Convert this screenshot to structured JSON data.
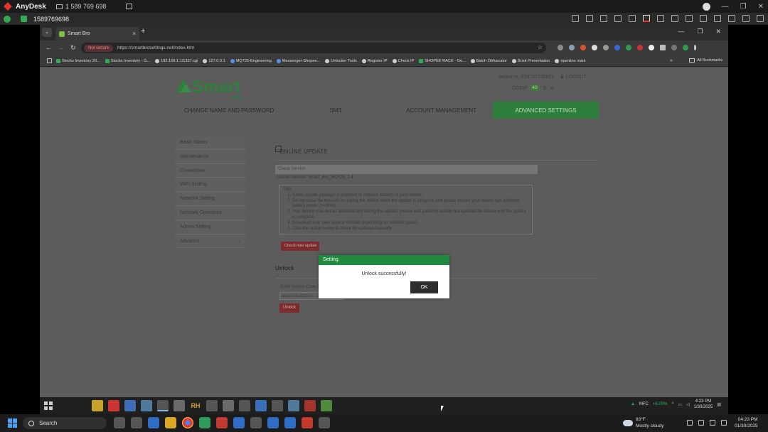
{
  "anydesk": {
    "title": "AnyDesk",
    "tab_label": "1 589 769 698",
    "session_id": "1589769698"
  },
  "browser": {
    "tab_title": "Smart Bro",
    "security": "Not secure",
    "url": "https://smartbrosettings.net/index.htm",
    "bookmarks": [
      "Stocks Inventory 20...",
      "Stocks Inventory - G...",
      "192.168.1.1/1337.cgi",
      "127.0.0.1",
      "MQ725-Engineering",
      "Messenger-Shopee...",
      "Unlocker Tools",
      "Register IP",
      "Check IP",
      "SHOPEE RACK - Go...",
      "Batch Obfuscator",
      "Brisk Presentation",
      "openline mark"
    ],
    "all_bookmarks": "All Bookmarks"
  },
  "page": {
    "logo_text": "Smart",
    "logo_sub": "Bro",
    "welcome": "welcome, 639761736921",
    "logout": "LOGOUT",
    "network": "COMP",
    "net_type": "4G",
    "nav": [
      "CHANGE NAME AND PASSWORD",
      "SMS",
      "ACCOUNT MANAGEMENT",
      "ADVANCED SETTINGS"
    ],
    "sidebar": [
      "Basic Status",
      "Maintenance",
      "Connection",
      "WiFi Setting",
      "Network Setting",
      "Network Operators",
      "Admin Setting",
      "Advance"
    ],
    "online_update": {
      "title": "ONLINE UPDATE",
      "check_version": "Check Version",
      "current_version": "Current version: Smart_Bro_MQ725_1.4",
      "tips_title": "Tips:",
      "tips": [
        "A new update package is provided to improve stability of your device.",
        "Do not close the browser or unplug the device when the update in progress and please ensure your device has sufficient battery power (>=30%).",
        "Your device may restart automatically during the update, please wait patiently and do not operate the device until the update is complete.",
        "Download may take several minutes depending on network speed.",
        "Click the button below to check for updates manually"
      ],
      "check_button": "Check new update"
    },
    "unlock": {
      "title": "Unlock",
      "label": "Enter Unlock Code from 1614 Unlock",
      "input_value": "6thxxx6A+62WSU",
      "button": "Unlock"
    }
  },
  "dialog": {
    "title": "Setting",
    "message": "Unlock successfully!",
    "ok": "OK"
  },
  "remote_taskbar": {
    "ticker": "MFC",
    "ticker_value": "+5.00%",
    "time": "4:23 PM",
    "date": "1/30/2025"
  },
  "local_taskbar": {
    "search": "Search",
    "temp": "83°F",
    "weather": "Mostly cloudy",
    "time": "04:23 PM",
    "date": "01/30/2025"
  },
  "colors": {
    "smart_green": "#2f7f3c",
    "dialog_green": "#1f8a3d",
    "button_red": "#7e2b2e",
    "anydesk_red": "#e2352c"
  }
}
